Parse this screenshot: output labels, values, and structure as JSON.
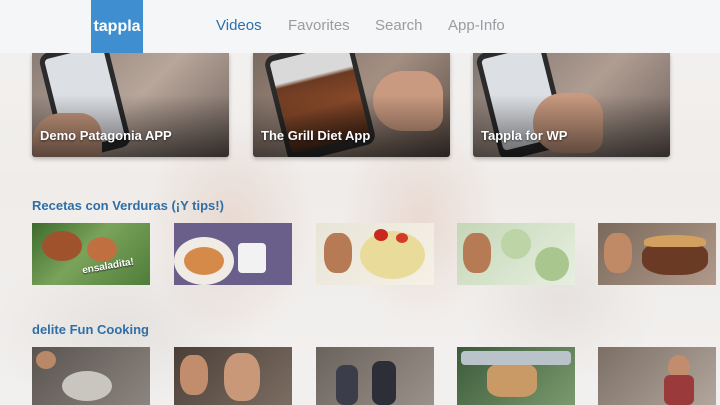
{
  "app": {
    "logo": "tappla"
  },
  "nav": {
    "tabs": [
      {
        "label": "Videos",
        "active": true
      },
      {
        "label": "Favorites",
        "active": false
      },
      {
        "label": "Search",
        "active": false
      },
      {
        "label": "App-Info",
        "active": false
      }
    ]
  },
  "featured": [
    {
      "title": "Demo Patagonia APP"
    },
    {
      "title": "The Grill Diet App"
    },
    {
      "title": "Tappla for WP"
    }
  ],
  "sections": [
    {
      "title": "Recetas con Verduras (¡Y tips!)",
      "thumbs": [
        {
          "caption": "ensaladita!"
        },
        {
          "caption": ""
        },
        {
          "caption": ""
        },
        {
          "caption": ""
        },
        {
          "caption": ""
        }
      ]
    },
    {
      "title": "delite Fun Cooking",
      "thumbs": [
        {
          "caption": ""
        },
        {
          "caption": ""
        },
        {
          "caption": ""
        },
        {
          "caption": ""
        },
        {
          "caption": ""
        }
      ]
    }
  ],
  "colors": {
    "accent": "#2f6fa8",
    "logo_bg": "#3f8fd0",
    "nav_inactive": "#9a9ca0"
  }
}
